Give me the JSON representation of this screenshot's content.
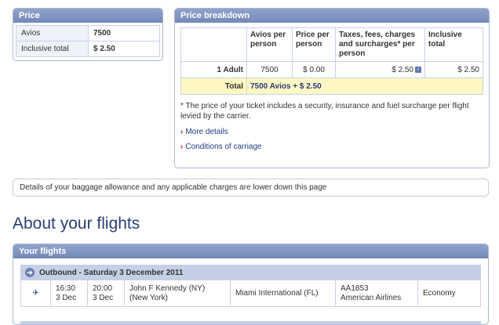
{
  "price": {
    "title": "Price",
    "rows": [
      {
        "label": "Avios",
        "value": "7500"
      },
      {
        "label": "Inclusive total",
        "value": "$ 2.50"
      }
    ]
  },
  "breakdown": {
    "title": "Price breakdown",
    "headers": [
      "Avios per person",
      "Price per person",
      "Taxes, fees, charges and surcharges* per person",
      "Inclusive total"
    ],
    "row": {
      "label": "1 Adult",
      "avios": "7500",
      "price": "$ 0.00",
      "taxes": "$ 2.50",
      "total": "$ 2.50"
    },
    "total_label": "Total",
    "total_value": "7500 Avios + $ 2.50",
    "note": "* The price of your ticket includes a security, insurance and fuel surcharge per flight levied by the carrier.",
    "links": [
      "More details",
      "Conditions of carriage"
    ]
  },
  "baggage_text": "Details of your baggage allowance and any applicable charges are lower down this page",
  "about_heading": "About your flights",
  "flights": {
    "title": "Your flights",
    "outbound_label": "Outbound - Saturday 3 December 2011",
    "flight": {
      "depart_time": "16:30",
      "depart_date": "3 Dec",
      "arrive_time": "20:00",
      "arrive_date": "3 Dec",
      "from": "John F Kennedy (NY) (New York)",
      "to": "Miami International (FL)",
      "flight_no": "AA1853",
      "airline": "American Airlines",
      "cabin": "Economy"
    }
  },
  "icons": {
    "info": "info-icon",
    "plane": "plane-icon",
    "arrow": "arrow-right-circle-icon",
    "chevron": "chevron-right-icon"
  },
  "colors": {
    "panel_header": "#7f93c0",
    "total_row": "#fff8c2",
    "link": "#243a80",
    "chevron": "#c0161e"
  }
}
